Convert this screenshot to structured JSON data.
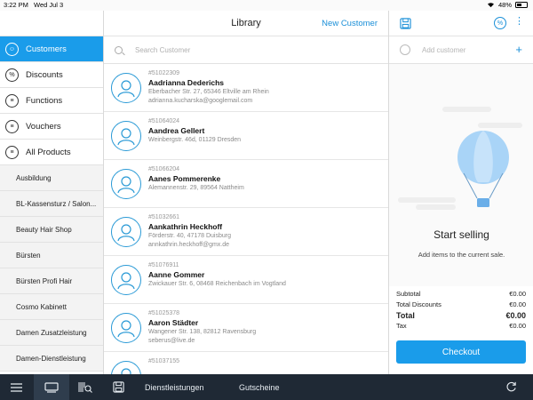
{
  "status_bar": {
    "time": "3:22 PM",
    "date": "Wed Jul 3",
    "battery": "48%"
  },
  "sidebar": {
    "items": [
      {
        "label": "Customers",
        "icon": "customer-icon",
        "active": true
      },
      {
        "label": "Discounts",
        "icon": "percent-icon"
      },
      {
        "label": "Functions",
        "icon": "list-icon"
      },
      {
        "label": "Vouchers",
        "icon": "list-icon"
      },
      {
        "label": "All Products",
        "icon": "list-icon"
      }
    ],
    "categories": [
      "Ausbildung",
      "BL-Kassensturz / Salon...",
      "Beauty Hair Shop",
      "Bürsten",
      "Bürsten Profi Hair",
      "Cosmo Kabinett",
      "Damen Zusatzleistung",
      "Damen-Dienstleistung"
    ]
  },
  "library": {
    "title": "Library",
    "new_customer": "New Customer",
    "search_placeholder": "Search Customer",
    "customers": [
      {
        "number": "#51022309",
        "name": "Aadrianna Dederichs",
        "address": "Eberbacher Str. 27, 65346 Eltville am Rhein",
        "email": "adrianna.kucharska@googlemail.com"
      },
      {
        "number": "#51064024",
        "name": "Aandrea Gellert",
        "address": "Weinbergstr. 46d, 01129 Dresden",
        "email": ""
      },
      {
        "number": "#51066204",
        "name": "Aanes Pommerenke",
        "address": "Alemannenstr. 29, 89564 Nattheim",
        "email": ""
      },
      {
        "number": "#51032661",
        "name": "Aankathrin Heckhoff",
        "address": "Förderstr. 40, 47178 Duisburg",
        "email": "annkathrin.heckhoff@gmx.de"
      },
      {
        "number": "#51076911",
        "name": "Aanne Gommer",
        "address": "Zwickauer Str. 6, 08468 Reichenbach im Vogtland",
        "email": ""
      },
      {
        "number": "#51025378",
        "name": "Aaron Städter",
        "address": "Wangener Str. 138, 82812 Ravensburg",
        "email": "seberus@live.de"
      },
      {
        "number": "#51037155",
        "name": "",
        "address": "",
        "email": ""
      }
    ]
  },
  "sale": {
    "add_customer": "Add customer",
    "start_selling": "Start selling",
    "start_sub": "Add items to the current sale.",
    "totals": [
      {
        "label": "Subtotal",
        "value": "€0.00",
        "big": false
      },
      {
        "label": "Total Discounts",
        "value": "€0.00",
        "big": false
      },
      {
        "label": "Total",
        "value": "€0.00",
        "big": true
      },
      {
        "label": "Tax",
        "value": "€0.00",
        "big": false
      }
    ],
    "checkout": "Checkout"
  },
  "bottom_bar": {
    "dienstleistungen": "Dienstleistungen",
    "gutscheine": "Gutscheine"
  },
  "colors": {
    "accent": "#1a9cea",
    "bottom_bar": "#1f2935"
  }
}
